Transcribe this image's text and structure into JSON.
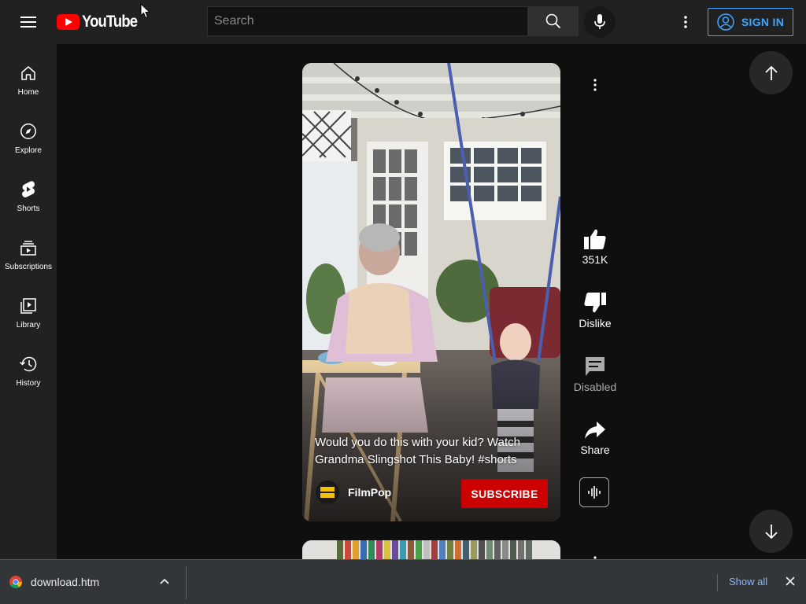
{
  "header": {
    "logo_text": "YouTube",
    "search_placeholder": "Search",
    "signin_label": "SIGN IN"
  },
  "sidebar": {
    "items": [
      {
        "label": "Home",
        "icon": "home-icon"
      },
      {
        "label": "Explore",
        "icon": "compass-icon"
      },
      {
        "label": "Shorts",
        "icon": "shorts-icon"
      },
      {
        "label": "Subscriptions",
        "icon": "subscriptions-icon"
      },
      {
        "label": "Library",
        "icon": "library-icon"
      },
      {
        "label": "History",
        "icon": "history-icon"
      }
    ]
  },
  "short": {
    "title": "Would you do this with your kid? Watch Grandma Slingshot This Baby! #shorts",
    "channel": "FilmPop",
    "subscribe_label": "SUBSCRIBE"
  },
  "actions": {
    "like_count": "351K",
    "dislike_label": "Dislike",
    "comments_label": "Disabled",
    "share_label": "Share"
  },
  "download_bar": {
    "filename": "download.htm",
    "show_all_label": "Show all"
  },
  "colors": {
    "brand_red": "#ff0000",
    "subscribe_red": "#cc0000",
    "link_blue": "#3ea6ff",
    "background": "#0f0f0f",
    "panel": "#212121"
  }
}
